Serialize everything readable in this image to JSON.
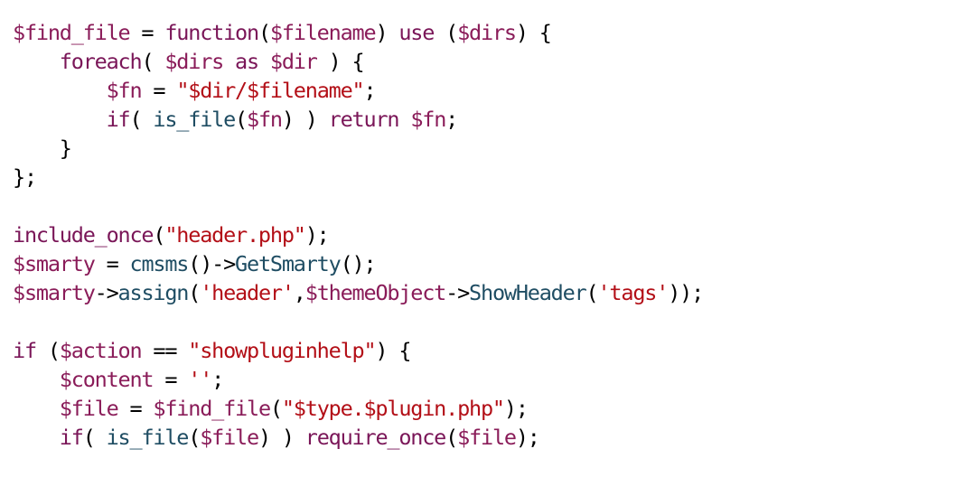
{
  "colors": {
    "variable": "#8a1c59",
    "keyword": "#7a1658",
    "function": "#1f4d63",
    "string": "#b30f17",
    "punctuation": "#000000",
    "background": "#ffffff"
  },
  "code": {
    "lines": [
      {
        "tokens": [
          {
            "t": "$find_file",
            "k": "var"
          },
          {
            "t": " = ",
            "k": "pun"
          },
          {
            "t": "function",
            "k": "kw"
          },
          {
            "t": "(",
            "k": "pun"
          },
          {
            "t": "$filename",
            "k": "var"
          },
          {
            "t": ") ",
            "k": "pun"
          },
          {
            "t": "use",
            "k": "kw"
          },
          {
            "t": " (",
            "k": "pun"
          },
          {
            "t": "$dirs",
            "k": "var"
          },
          {
            "t": ") {",
            "k": "pun"
          }
        ]
      },
      {
        "tokens": [
          {
            "t": "    ",
            "k": "pun"
          },
          {
            "t": "foreach",
            "k": "kw"
          },
          {
            "t": "( ",
            "k": "pun"
          },
          {
            "t": "$dirs",
            "k": "var"
          },
          {
            "t": " ",
            "k": "pun"
          },
          {
            "t": "as",
            "k": "kw"
          },
          {
            "t": " ",
            "k": "pun"
          },
          {
            "t": "$dir",
            "k": "var"
          },
          {
            "t": " ) {",
            "k": "pun"
          }
        ]
      },
      {
        "tokens": [
          {
            "t": "        ",
            "k": "pun"
          },
          {
            "t": "$fn",
            "k": "var"
          },
          {
            "t": " = ",
            "k": "pun"
          },
          {
            "t": "\"$dir/$filename\"",
            "k": "str"
          },
          {
            "t": ";",
            "k": "pun"
          }
        ]
      },
      {
        "tokens": [
          {
            "t": "        ",
            "k": "pun"
          },
          {
            "t": "if",
            "k": "kw"
          },
          {
            "t": "( ",
            "k": "pun"
          },
          {
            "t": "is_file",
            "k": "fn"
          },
          {
            "t": "(",
            "k": "pun"
          },
          {
            "t": "$fn",
            "k": "var"
          },
          {
            "t": ") ) ",
            "k": "pun"
          },
          {
            "t": "return",
            "k": "kw"
          },
          {
            "t": " ",
            "k": "pun"
          },
          {
            "t": "$fn",
            "k": "var"
          },
          {
            "t": ";",
            "k": "pun"
          }
        ]
      },
      {
        "tokens": [
          {
            "t": "    }",
            "k": "pun"
          }
        ]
      },
      {
        "tokens": [
          {
            "t": "};",
            "k": "pun"
          }
        ]
      },
      {
        "tokens": []
      },
      {
        "tokens": [
          {
            "t": "include_once",
            "k": "kw"
          },
          {
            "t": "(",
            "k": "pun"
          },
          {
            "t": "\"header.php\"",
            "k": "str"
          },
          {
            "t": ");",
            "k": "pun"
          }
        ]
      },
      {
        "tokens": [
          {
            "t": "$smarty",
            "k": "var"
          },
          {
            "t": " = ",
            "k": "pun"
          },
          {
            "t": "cmsms",
            "k": "fn"
          },
          {
            "t": "()->",
            "k": "pun"
          },
          {
            "t": "GetSmarty",
            "k": "fn"
          },
          {
            "t": "();",
            "k": "pun"
          }
        ]
      },
      {
        "tokens": [
          {
            "t": "$smarty",
            "k": "var"
          },
          {
            "t": "->",
            "k": "pun"
          },
          {
            "t": "assign",
            "k": "fn"
          },
          {
            "t": "(",
            "k": "pun"
          },
          {
            "t": "'header'",
            "k": "str"
          },
          {
            "t": ",",
            "k": "pun"
          },
          {
            "t": "$themeObject",
            "k": "var"
          },
          {
            "t": "->",
            "k": "pun"
          },
          {
            "t": "ShowHeader",
            "k": "fn"
          },
          {
            "t": "(",
            "k": "pun"
          },
          {
            "t": "'tags'",
            "k": "str"
          },
          {
            "t": "));",
            "k": "pun"
          }
        ]
      },
      {
        "tokens": []
      },
      {
        "tokens": [
          {
            "t": "if",
            "k": "kw"
          },
          {
            "t": " (",
            "k": "pun"
          },
          {
            "t": "$action",
            "k": "var"
          },
          {
            "t": " == ",
            "k": "pun"
          },
          {
            "t": "\"showpluginhelp\"",
            "k": "str"
          },
          {
            "t": ") {",
            "k": "pun"
          }
        ]
      },
      {
        "tokens": [
          {
            "t": "    ",
            "k": "pun"
          },
          {
            "t": "$content",
            "k": "var"
          },
          {
            "t": " = ",
            "k": "pun"
          },
          {
            "t": "''",
            "k": "str"
          },
          {
            "t": ";",
            "k": "pun"
          }
        ]
      },
      {
        "tokens": [
          {
            "t": "    ",
            "k": "pun"
          },
          {
            "t": "$file",
            "k": "var"
          },
          {
            "t": " = ",
            "k": "pun"
          },
          {
            "t": "$find_file",
            "k": "var"
          },
          {
            "t": "(",
            "k": "pun"
          },
          {
            "t": "\"$type.$plugin.php\"",
            "k": "str"
          },
          {
            "t": ");",
            "k": "pun"
          }
        ]
      },
      {
        "tokens": [
          {
            "t": "    ",
            "k": "pun"
          },
          {
            "t": "if",
            "k": "kw"
          },
          {
            "t": "( ",
            "k": "pun"
          },
          {
            "t": "is_file",
            "k": "fn"
          },
          {
            "t": "(",
            "k": "pun"
          },
          {
            "t": "$file",
            "k": "var"
          },
          {
            "t": ") ) ",
            "k": "pun"
          },
          {
            "t": "require_once",
            "k": "kw"
          },
          {
            "t": "(",
            "k": "pun"
          },
          {
            "t": "$file",
            "k": "var"
          },
          {
            "t": ");",
            "k": "pun"
          }
        ]
      }
    ]
  }
}
